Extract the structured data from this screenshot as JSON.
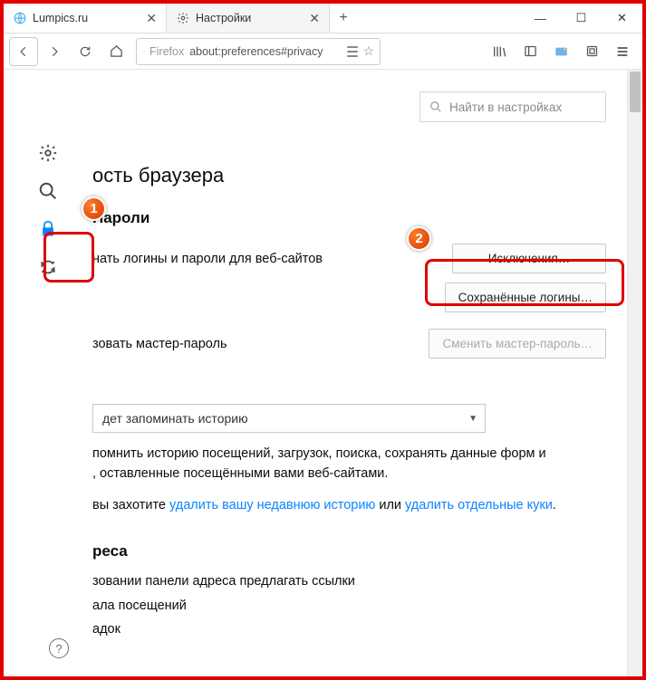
{
  "tabs": [
    {
      "label": "Lumpics.ru",
      "active": false,
      "icon": "globe"
    },
    {
      "label": "Настройки",
      "active": true,
      "icon": "gear"
    }
  ],
  "window_controls": {
    "min": "—",
    "max": "☐",
    "close": "✕"
  },
  "toolbar": {
    "identity_label": "Firefox",
    "url": "about:preferences#privacy"
  },
  "search": {
    "placeholder": "Найти в настройках"
  },
  "sidebar": {
    "items": [
      {
        "name": "general",
        "icon": "gear"
      },
      {
        "name": "search",
        "icon": "search"
      },
      {
        "name": "privacy",
        "icon": "lock",
        "active": true
      },
      {
        "name": "sync",
        "icon": "sync"
      }
    ]
  },
  "page": {
    "heading_fragment": "ость браузера",
    "section_passwords": "Пароли",
    "remember_logins_fragment": "нать логины и пароли для веб-сайтов",
    "exceptions_btn": "Исключения…",
    "saved_logins_btn": "Сохранённые логины…",
    "master_pw_fragment": "зовать мастер-пароль",
    "change_master_btn": "Сменить мастер-пароль…",
    "history_select_fragment": "дет запоминать историю",
    "history_para_line1": "помнить историю посещений, загрузок, поиска, сохранять данные форм и",
    "history_para_line2": ", оставленные посещёнными вами веб-сайтами.",
    "history_para2_prefix": "вы захотите ",
    "history_link1": "удалить вашу недавнюю историю",
    "history_para2_mid": " или ",
    "history_link2": "удалить отдельные куки",
    "history_para2_suffix": ".",
    "section_address": "реса",
    "address_line1": "зовании панели адреса предлагать ссылки",
    "address_line2": "ала посещений",
    "address_line3": "адок"
  },
  "markers": {
    "m1": "1",
    "m2": "2"
  }
}
